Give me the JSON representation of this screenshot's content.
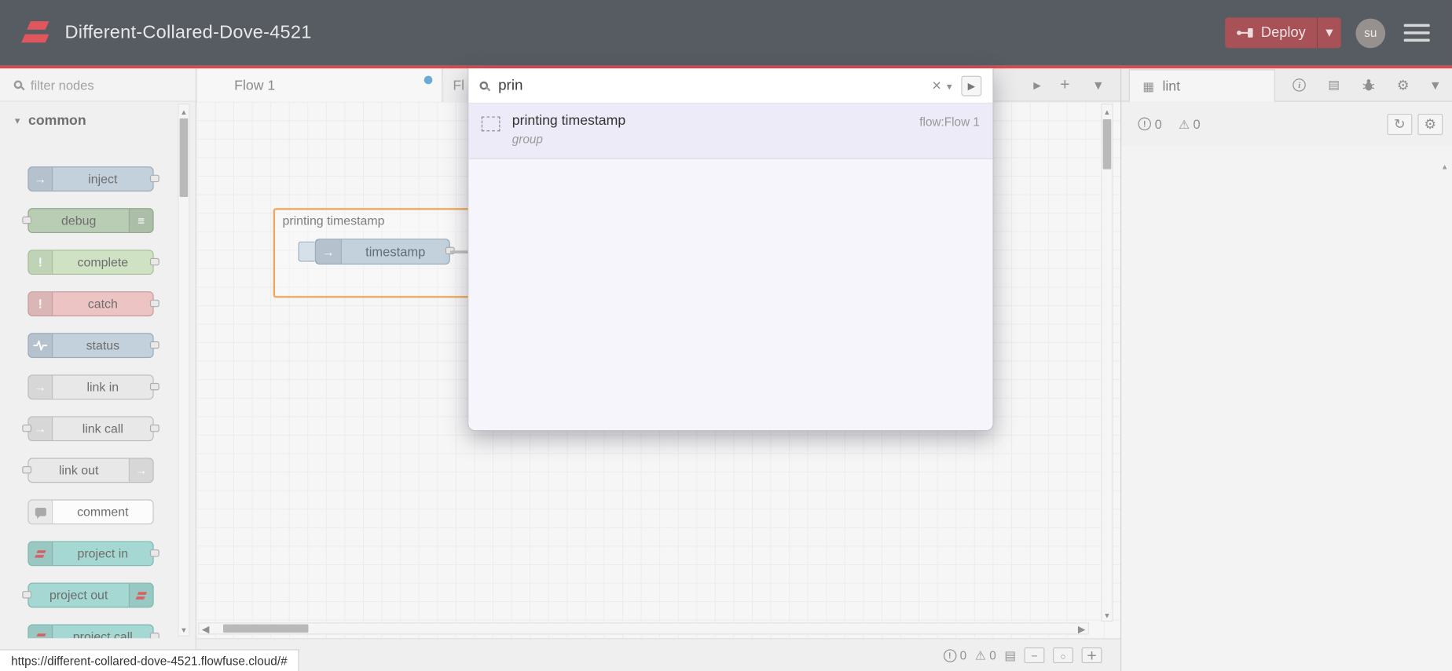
{
  "colors": {
    "header_bg": "#575c62",
    "accent_red": "#d94a4f",
    "deploy_bg": "#a85157",
    "group_border": "#f2a85c",
    "result_panel_bg": "#f5f5fb"
  },
  "header": {
    "title": "Different-Collared-Dove-4521",
    "deploy": {
      "label": "Deploy"
    },
    "avatar": {
      "initials": "su"
    }
  },
  "palette": {
    "filter_placeholder": "filter nodes",
    "category_label": "common",
    "nodes": [
      {
        "label": "inject",
        "icon": "inject-arrow-icon",
        "color": "#c3d1dd",
        "border": "#9aabb8"
      },
      {
        "label": "debug",
        "icon": "debug-panel-icon",
        "color": "#b9cdb4",
        "border": "#93a88e"
      },
      {
        "label": "complete",
        "icon": "alert-icon",
        "color": "#cfe3c4",
        "border": "#a3bd97"
      },
      {
        "label": "catch",
        "icon": "alert-icon",
        "color": "#ecc4c4",
        "border": "#c69c9c"
      },
      {
        "label": "status",
        "icon": "heartbeat-icon",
        "color": "#c3d1dd",
        "border": "#9aabb8"
      },
      {
        "label": "link in",
        "icon": "link-arrow-icon",
        "color": "#e8e8e8",
        "border": "#bcbcbc"
      },
      {
        "label": "link call",
        "icon": "link-arrow-icon",
        "color": "#e8e8e8",
        "border": "#bcbcbc"
      },
      {
        "label": "link out",
        "icon": "link-arrow-icon",
        "color": "#e8e8e8",
        "border": "#bcbcbc"
      },
      {
        "label": "comment",
        "icon": "comment-bubble-icon",
        "color": "#fcfcfc",
        "border": "#c6c6c6"
      },
      {
        "label": "project in",
        "icon": "flowfuse-icon",
        "color": "#a5d8d2",
        "border": "#7cb8b1"
      },
      {
        "label": "project out",
        "icon": "flowfuse-icon",
        "color": "#a5d8d2",
        "border": "#7cb8b1"
      },
      {
        "label": "project call",
        "icon": "flowfuse-icon",
        "color": "#a5d8d2",
        "border": "#7cb8b1"
      }
    ]
  },
  "tabbar": {
    "active_tab": "Flow 1",
    "partial_tab": "Fl"
  },
  "canvas": {
    "group_label": "printing timestamp",
    "inject_node_label": "timestamp"
  },
  "search": {
    "query": "prin",
    "results": [
      {
        "title": "printing timestamp",
        "flow": "flow:Flow 1",
        "kind": "group"
      }
    ]
  },
  "sidebar": {
    "tab_label": "lint",
    "error_count": "0",
    "warning_count": "0"
  },
  "statusbar": {
    "error_count": "0",
    "warning_count": "0"
  },
  "browser": {
    "status_url": "https://different-collared-dove-4521.flowfuse.cloud/#"
  }
}
